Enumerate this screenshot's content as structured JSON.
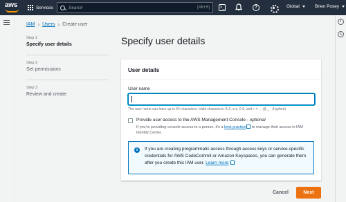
{
  "topbar": {
    "logo_text": "aws",
    "services_label": "Services",
    "search_placeholder": "Search",
    "search_shortcut": "[Alt+S]",
    "region_label": "Global",
    "user_label": "Brien Posey",
    "icons": [
      "cloudshell-icon",
      "bell-icon",
      "help-icon",
      "gear-icon"
    ]
  },
  "breadcrumb": {
    "items": [
      "IAM",
      "Users",
      "Create user"
    ]
  },
  "steps": [
    {
      "num": "Step 1",
      "name": "Specify user details",
      "active": true
    },
    {
      "num": "Step 2",
      "name": "Set permissions",
      "active": false
    },
    {
      "num": "Step 3",
      "name": "Review and create",
      "active": false
    }
  ],
  "page_title": "Specify user details",
  "panel": {
    "title": "User details",
    "username_label": "User name",
    "username_value": "",
    "username_hint": "The user name can have up to 64 characters. Valid characters: A-Z, a-z, 0-9, and + = , . @ _ - (hyphen)",
    "console_access": {
      "label": "Provide user access to the AWS Management Console - ",
      "label_optional": "optional",
      "checked": false,
      "desc_before": "If you're providing console access to a person, it's a ",
      "desc_link": "best practice",
      "desc_after": " to manage their access in IAM Identity Center."
    },
    "info": {
      "text": "If you are creating programmatic access through access keys or service-specific credentials for AWS CodeCommit or Amazon Keyspaces, you can generate them after you create this IAM user. ",
      "link": "Learn more"
    }
  },
  "actions": {
    "cancel_label": "Cancel",
    "next_label": "Next"
  },
  "colors": {
    "topbar_bg": "#232f3e",
    "accent_orange": "#ec7211",
    "link_blue": "#0073bb"
  }
}
